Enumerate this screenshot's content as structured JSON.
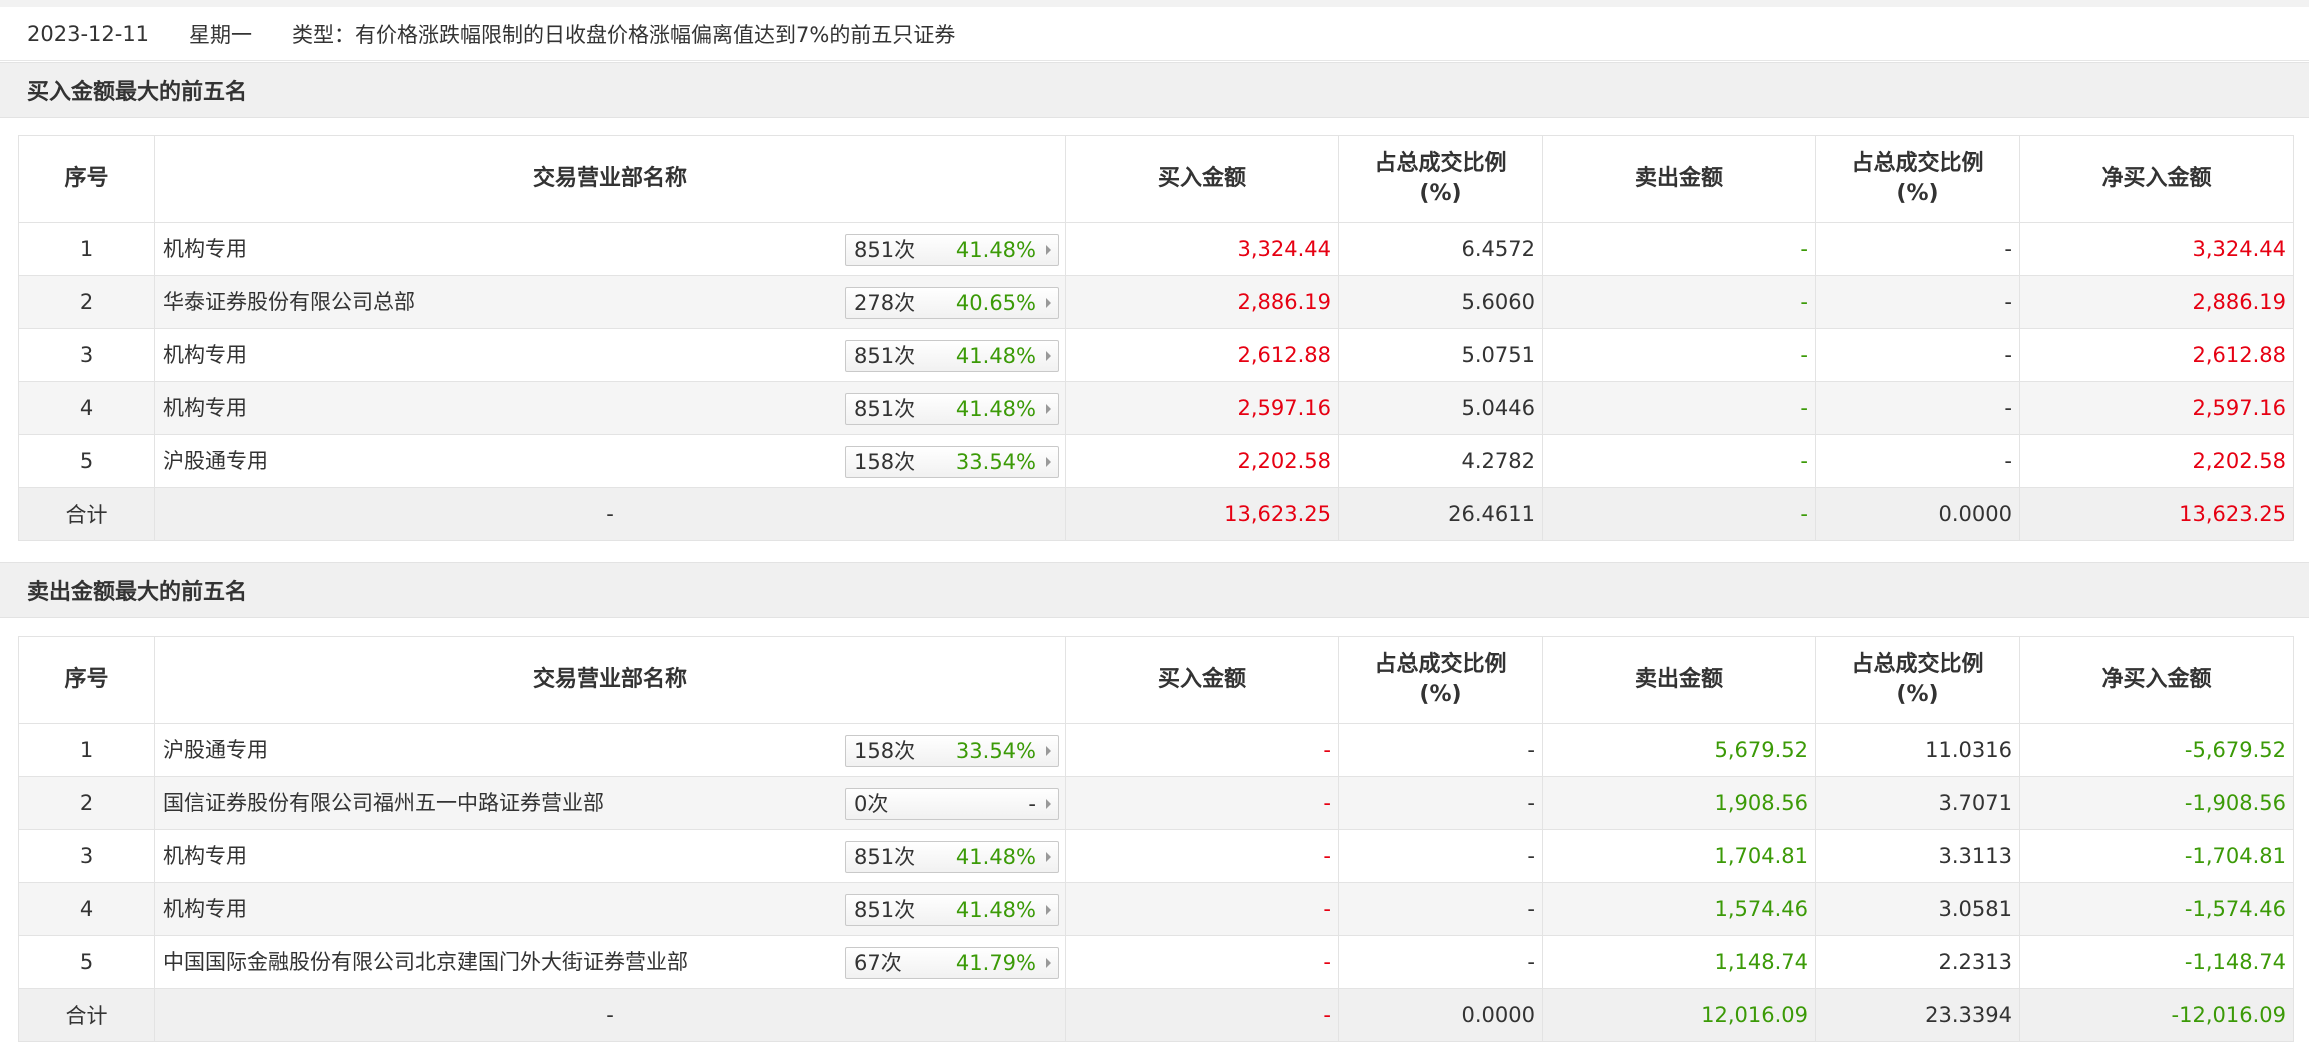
{
  "header": {
    "date": "2023-12-11",
    "weekday": "星期一",
    "type_text": "类型：有价格涨跌幅限制的日收盘价格涨幅偏离值达到7%的前五只证券"
  },
  "colors": {
    "red": "#e60012",
    "green": "#3b9a07"
  },
  "columns": [
    "序号",
    "交易营业部名称",
    "买入金额",
    "占总成交比例",
    "(%)",
    "卖出金额",
    "占总成交比例",
    "(%)",
    "净买入金额"
  ],
  "buy": {
    "title": "买入金额最大的前五名",
    "rows": [
      {
        "idx": "1",
        "name": "机构专用",
        "count": "851次",
        "rate": "41.48%",
        "buy": "3,324.44",
        "buy_pct": "6.4572",
        "sell": "-",
        "sell_pct": "-",
        "net": "3,324.44"
      },
      {
        "idx": "2",
        "name": "华泰证券股份有限公司总部",
        "count": "278次",
        "rate": "40.65%",
        "buy": "2,886.19",
        "buy_pct": "5.6060",
        "sell": "-",
        "sell_pct": "-",
        "net": "2,886.19"
      },
      {
        "idx": "3",
        "name": "机构专用",
        "count": "851次",
        "rate": "41.48%",
        "buy": "2,612.88",
        "buy_pct": "5.0751",
        "sell": "-",
        "sell_pct": "-",
        "net": "2,612.88"
      },
      {
        "idx": "4",
        "name": "机构专用",
        "count": "851次",
        "rate": "41.48%",
        "buy": "2,597.16",
        "buy_pct": "5.0446",
        "sell": "-",
        "sell_pct": "-",
        "net": "2,597.16"
      },
      {
        "idx": "5",
        "name": "沪股通专用",
        "count": "158次",
        "rate": "33.54%",
        "buy": "2,202.58",
        "buy_pct": "4.2782",
        "sell": "-",
        "sell_pct": "-",
        "net": "2,202.58"
      }
    ],
    "total": {
      "label": "合计",
      "name": "-",
      "buy": "13,623.25",
      "buy_pct": "26.4611",
      "sell": "-",
      "sell_pct": "0.0000",
      "net": "13,623.25"
    }
  },
  "sell": {
    "title": "卖出金额最大的前五名",
    "rows": [
      {
        "idx": "1",
        "name": "沪股通专用",
        "count": "158次",
        "rate": "33.54%",
        "buy": "-",
        "buy_pct": "-",
        "sell": "5,679.52",
        "sell_pct": "11.0316",
        "net": "-5,679.52"
      },
      {
        "idx": "2",
        "name": "国信证券股份有限公司福州五一中路证券营业部",
        "count": "0次",
        "rate": "-",
        "buy": "-",
        "buy_pct": "-",
        "sell": "1,908.56",
        "sell_pct": "3.7071",
        "net": "-1,908.56"
      },
      {
        "idx": "3",
        "name": "机构专用",
        "count": "851次",
        "rate": "41.48%",
        "buy": "-",
        "buy_pct": "-",
        "sell": "1,704.81",
        "sell_pct": "3.3113",
        "net": "-1,704.81"
      },
      {
        "idx": "4",
        "name": "机构专用",
        "count": "851次",
        "rate": "41.48%",
        "buy": "-",
        "buy_pct": "-",
        "sell": "1,574.46",
        "sell_pct": "3.0581",
        "net": "-1,574.46"
      },
      {
        "idx": "5",
        "name": "中国国际金融股份有限公司北京建国门外大街证券营业部",
        "count": "67次",
        "rate": "41.79%",
        "buy": "-",
        "buy_pct": "-",
        "sell": "1,148.74",
        "sell_pct": "2.2313",
        "net": "-1,148.74"
      }
    ],
    "total": {
      "label": "合计",
      "name": "-",
      "buy": "-",
      "buy_pct": "0.0000",
      "sell": "12,016.09",
      "sell_pct": "23.3394",
      "net": "-12,016.09"
    }
  }
}
